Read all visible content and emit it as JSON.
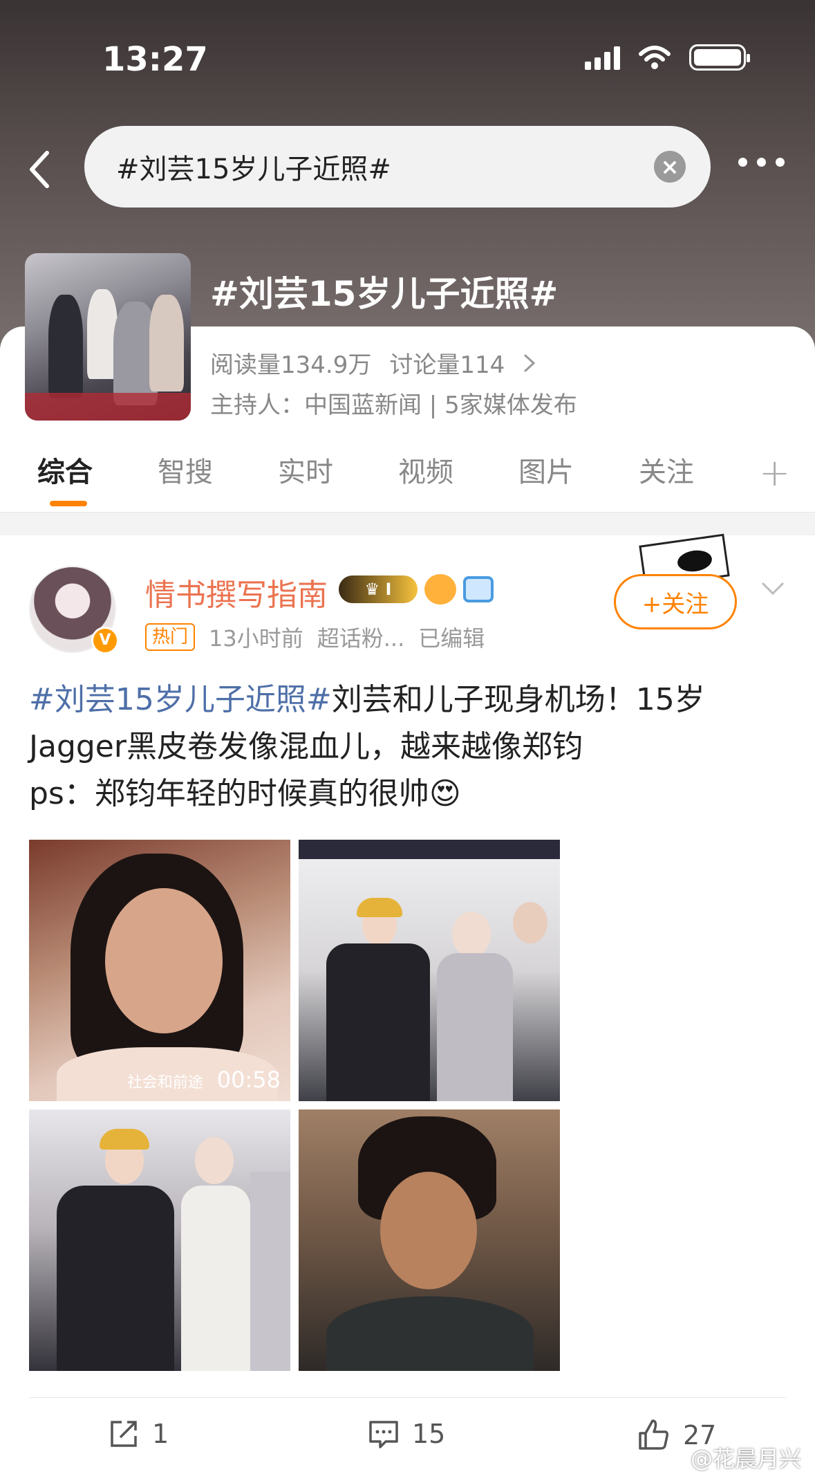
{
  "status_bar": {
    "time": "13:27"
  },
  "search": {
    "query": "#刘芸15岁儿子近照#"
  },
  "topic": {
    "title": "#刘芸15岁儿子近照#",
    "reads": "阅读量134.9万",
    "discussions": "讨论量114",
    "host": "主持人：中国蓝新闻 | 5家媒体发布"
  },
  "tabs": [
    {
      "label": "综合",
      "active": true
    },
    {
      "label": "智搜",
      "active": false
    },
    {
      "label": "实时",
      "active": false
    },
    {
      "label": "视频",
      "active": false
    },
    {
      "label": "图片",
      "active": false
    },
    {
      "label": "关注",
      "active": false
    }
  ],
  "tab_add": "+",
  "post": {
    "username": "情书撰写指南",
    "badge_text": "I",
    "hot_tag": "热门",
    "time": "13小时前",
    "source": "超话粉...",
    "edited": "已编辑",
    "follow_label": "+关注",
    "text_tag": "#刘芸15岁儿子近照#",
    "text_line1": "刘芸和儿子现身机场！15岁",
    "text_line2": "Jagger黑皮卷发像混血儿，越来越像郑钧",
    "text_line3": "ps：郑钧年轻的时候真的很帅",
    "emoji": "😍",
    "video": {
      "source": "社会和前途",
      "duration": "00:58"
    },
    "actions": {
      "repost": "1",
      "comment": "15",
      "like": "27"
    }
  },
  "watermark": "@花晨月兴",
  "colors": {
    "accent": "#ff8200",
    "username": "#eb7350",
    "tag": "#4e6fa8"
  }
}
